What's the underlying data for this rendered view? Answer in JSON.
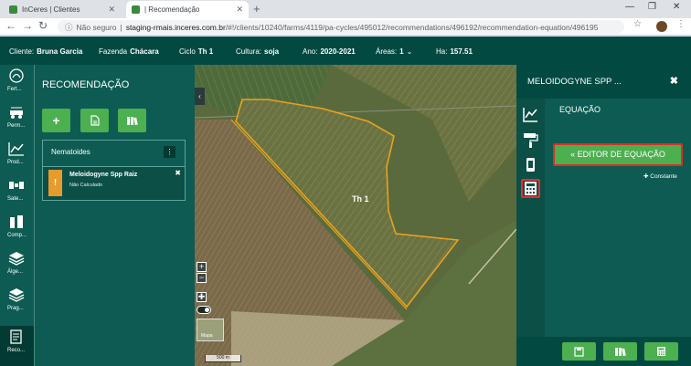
{
  "browser": {
    "tabs": [
      {
        "title": "InCeres | Clientes",
        "active": false
      },
      {
        "title": "| Recomendação",
        "active": true
      }
    ],
    "new_tab": "+",
    "window_controls": {
      "minimize": "—",
      "maximize": "❐",
      "close": "✕"
    },
    "security_label": "Não seguro",
    "url_host": "staging-rmais.inceres.com.br",
    "url_path": "/#!/clients/10240/farms/4119/pa-cycles/495012/recommendations/496192/recommendation-equation/496195"
  },
  "topbar": {
    "client_label": "Cliente:",
    "client_value": "Bruna Garcia",
    "farm_label": "Fazenda",
    "farm_value": "Chácara",
    "cycle_label": "Ciclo",
    "cycle_value": "Th 1",
    "crop_label": "Cultura:",
    "crop_value": "soja",
    "year_label": "Ano:",
    "year_value": "2020-2021",
    "areas_label": "Áreas:",
    "areas_value": "1",
    "ha_label": "Ha:",
    "ha_value": "157.51"
  },
  "sidebar": {
    "items": [
      {
        "label": "Fert...",
        "icon": "fertility-icon"
      },
      {
        "label": "Perm...",
        "icon": "sprayer-icon"
      },
      {
        "label": "Prod...",
        "icon": "chart-line-icon"
      },
      {
        "label": "Sate...",
        "icon": "satellite-icon"
      },
      {
        "label": "Comp...",
        "icon": "compare-icon"
      },
      {
        "label": "Álge...",
        "icon": "layers-icon"
      },
      {
        "label": "Prag...",
        "icon": "layers-alt-icon"
      },
      {
        "label": "Reco...",
        "icon": "recommendation-icon",
        "active": true
      }
    ]
  },
  "left_panel": {
    "title": "RECOMENDAÇÃO",
    "actions": [
      {
        "name": "add",
        "glyph": "+"
      },
      {
        "name": "document",
        "glyph": "🗎"
      },
      {
        "name": "books",
        "glyph": "▮▮"
      }
    ],
    "group_title": "Nematoides",
    "menu_glyph": "⋮",
    "item": {
      "name": "Meloidogyne Spp Raiz",
      "status": "Não Calculado",
      "warn_glyph": "!",
      "close_glyph": "✖"
    }
  },
  "map": {
    "field_label": "Th 1",
    "zoom_in": "+",
    "zoom_out": "−",
    "pan": "✚",
    "tile_label": "Mapa",
    "scale_label": "500 m",
    "collapse_glyph": "‹"
  },
  "right_panel": {
    "title": "MELOIDOGYNE SPP ...",
    "close_glyph": "✖",
    "section_title": "EQUAÇÃO",
    "editor_button": "« EDITOR DE EQUAÇÃO",
    "constant_button": "✚ Constante",
    "rail": [
      {
        "icon": "chart-line-icon"
      },
      {
        "icon": "paint-roller-icon"
      },
      {
        "icon": "tablet-icon"
      },
      {
        "icon": "calculator-icon",
        "selected": true
      }
    ],
    "footer": [
      {
        "icon": "save-icon"
      },
      {
        "icon": "books-icon"
      },
      {
        "icon": "calculator-icon"
      }
    ]
  },
  "colors": {
    "header": "#024a41",
    "panel": "#0d5b52",
    "accent_green": "#4caf50",
    "warning_orange": "#e89b2a",
    "highlight_red": "#d93025",
    "field_outline": "#e8a31f"
  }
}
